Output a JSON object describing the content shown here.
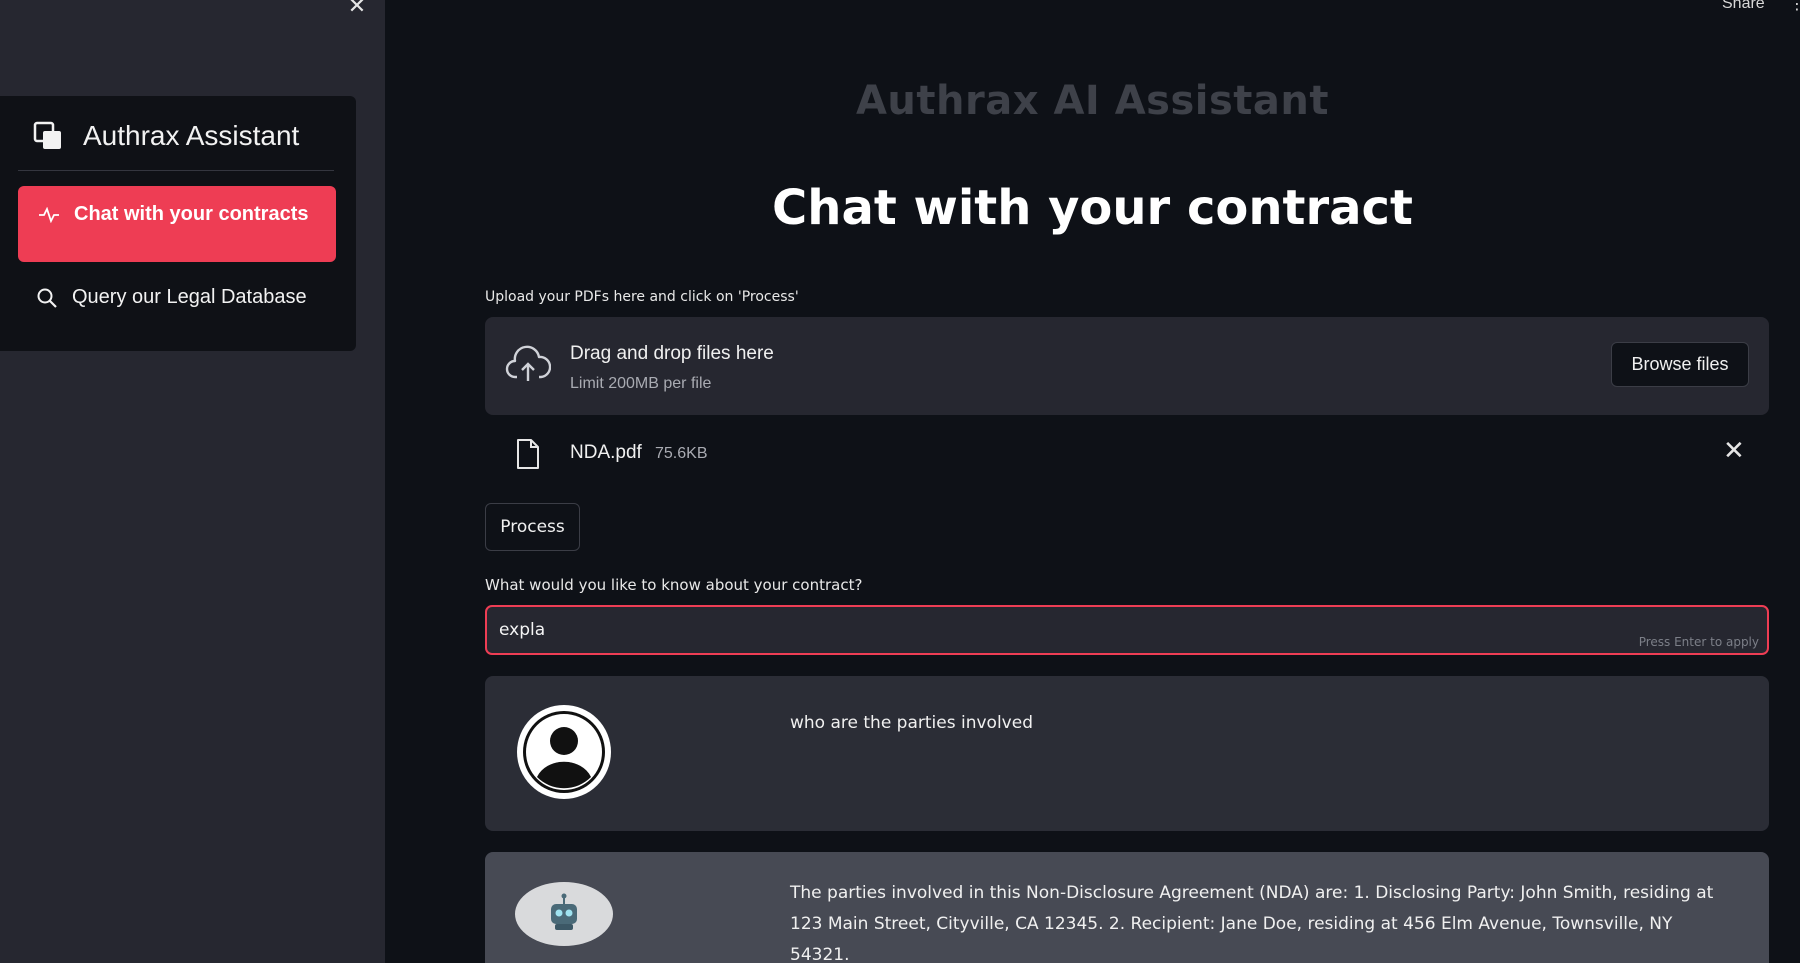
{
  "window": {
    "share_label": "Share"
  },
  "sidebar": {
    "close_glyph": "✕",
    "brand": "Authrax Assistant",
    "items": [
      {
        "label": "Chat with your contracts",
        "icon": "activity-icon",
        "active": true
      },
      {
        "label": "Query our Legal Database",
        "icon": "search-icon",
        "active": false
      }
    ]
  },
  "main": {
    "app_title": "Authrax AI Assistant",
    "page_title": "Chat with your contract",
    "upload": {
      "label": "Upload your PDFs here and click on 'Process'",
      "drop_main": "Drag and drop files here",
      "drop_sub": "Limit 200MB per file",
      "browse_label": "Browse files"
    },
    "file": {
      "name": "NDA.pdf",
      "size": "75.6KB"
    },
    "process_label": "Process",
    "question": {
      "label": "What would you like to know about your contract?",
      "value": "expla",
      "hint": "Press Enter to apply"
    },
    "messages": [
      {
        "role": "user",
        "text": "who are the parties involved"
      },
      {
        "role": "bot",
        "text": "The parties involved in this Non-Disclosure Agreement (NDA) are: 1. Disclosing Party: John Smith, residing at 123 Main Street, Cityville, CA 12345. 2. Recipient: Jane Doe, residing at 456 Elm Avenue, Townsville, NY 54321."
      }
    ]
  },
  "colors": {
    "accent": "#ee3d54",
    "background": "#0e1117",
    "sidebar": "#262730"
  }
}
